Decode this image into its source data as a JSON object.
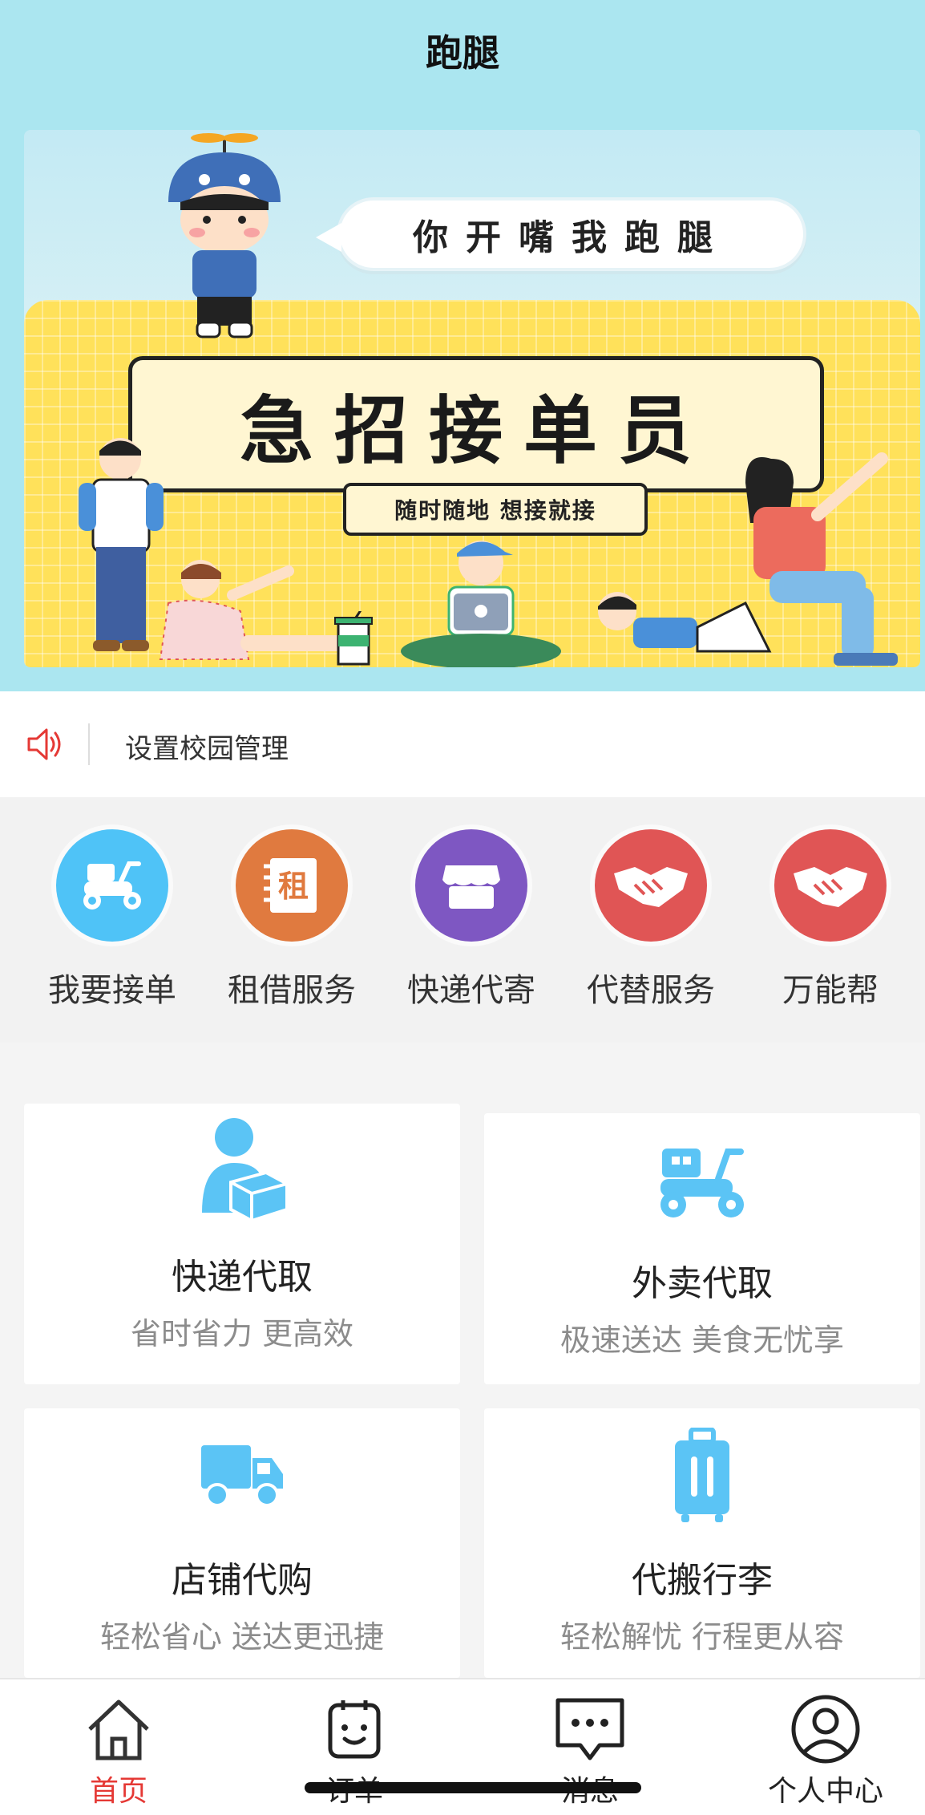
{
  "header": {
    "title": "跑腿"
  },
  "banner": {
    "speech": "你开嘴我跑腿",
    "headline": "急招接单员",
    "subline": "随时随地  想接就接"
  },
  "notice": {
    "icon": "speaker-icon",
    "text": "设置校园管理"
  },
  "categories": [
    {
      "label": "我要接单",
      "icon": "scooter-icon",
      "color": "#4fc3f7"
    },
    {
      "label": "租借服务",
      "icon": "rent-icon",
      "color": "#e07a3f"
    },
    {
      "label": "快递代寄",
      "icon": "shop-icon",
      "color": "#7e57c2"
    },
    {
      "label": "代替服务",
      "icon": "handshake-icon",
      "color": "#e05555"
    },
    {
      "label": "万能帮",
      "icon": "handshake-icon",
      "color": "#e05555"
    }
  ],
  "services": [
    {
      "title": "快递代取",
      "desc": "省时省力 更高效",
      "icon": "person-box-icon"
    },
    {
      "title": "外卖代取",
      "desc": "极速送达 美食无忧享",
      "icon": "delivery-scooter-icon"
    },
    {
      "title": "店铺代购",
      "desc": "轻松省心 送达更迅捷",
      "icon": "truck-icon"
    },
    {
      "title": "代搬行李",
      "desc": "轻松解忧 行程更从容",
      "icon": "suitcase-icon"
    }
  ],
  "tabs": [
    {
      "label": "首页",
      "icon": "home-icon",
      "active": true
    },
    {
      "label": "订单",
      "icon": "order-icon",
      "active": false
    },
    {
      "label": "消息",
      "icon": "message-icon",
      "active": false
    },
    {
      "label": "个人中心",
      "icon": "user-icon",
      "active": false
    }
  ],
  "colors": {
    "accent": "#e53935",
    "header_bg": "#abe6f0",
    "service_icon": "#5bc4f5"
  }
}
